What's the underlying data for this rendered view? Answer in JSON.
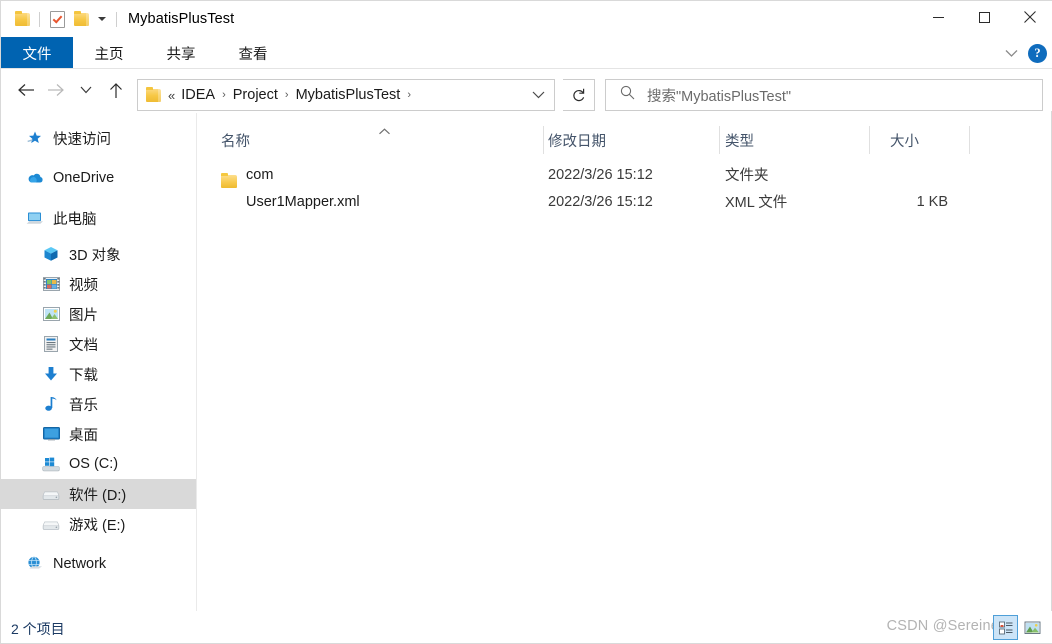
{
  "window": {
    "title": "MybatisPlusTest",
    "quick_access": [
      {
        "name": "folder-icon",
        "label": "文件夹"
      },
      {
        "name": "properties-icon",
        "label": "属性"
      },
      {
        "name": "new-folder-icon",
        "label": "新建文件夹"
      },
      {
        "name": "customize-caret-icon",
        "label": "自定义快速访问工具栏"
      }
    ],
    "controls": {
      "minimize": "最小化",
      "maximize": "最大化",
      "close": "关闭"
    }
  },
  "ribbon": {
    "tabs": [
      {
        "label": "文件",
        "active": true
      },
      {
        "label": "主页",
        "active": false
      },
      {
        "label": "共享",
        "active": false
      },
      {
        "label": "查看",
        "active": false
      }
    ],
    "collapse_icon": "chevron-down-icon",
    "help_label": "?"
  },
  "navigation": {
    "back_label": "返回",
    "forward_label": "前进",
    "recent_label": "最近使用的位置",
    "up_label": "向上",
    "breadcrumb": {
      "overflow": "«",
      "items": [
        "IDEA",
        "Project",
        "MybatisPlusTest"
      ],
      "separator": "›",
      "trailing_separator": "›"
    },
    "refresh_label": "刷新",
    "search": {
      "placeholder": "搜索\"MybatisPlusTest\"",
      "icon": "search-icon"
    }
  },
  "sidebar": {
    "items": [
      {
        "label": "快速访问",
        "icon": "star-pin-icon",
        "indent": 0,
        "selected": false
      },
      {
        "label": "OneDrive",
        "icon": "cloud-icon",
        "indent": 0,
        "selected": false
      },
      {
        "label": "此电脑",
        "icon": "this-pc-icon",
        "indent": 0,
        "selected": false
      },
      {
        "label": "3D 对象",
        "icon": "3d-objects-icon",
        "indent": 1,
        "selected": false
      },
      {
        "label": "视频",
        "icon": "videos-icon",
        "indent": 1,
        "selected": false
      },
      {
        "label": "图片",
        "icon": "pictures-icon",
        "indent": 1,
        "selected": false
      },
      {
        "label": "文档",
        "icon": "documents-icon",
        "indent": 1,
        "selected": false
      },
      {
        "label": "下载",
        "icon": "downloads-icon",
        "indent": 1,
        "selected": false
      },
      {
        "label": "音乐",
        "icon": "music-icon",
        "indent": 1,
        "selected": false
      },
      {
        "label": "桌面",
        "icon": "desktop-icon",
        "indent": 1,
        "selected": false
      },
      {
        "label": "OS (C:)",
        "icon": "windows-drive-icon",
        "indent": 1,
        "selected": false
      },
      {
        "label": "软件 (D:)",
        "icon": "drive-icon",
        "indent": 1,
        "selected": true
      },
      {
        "label": "游戏 (E:)",
        "icon": "drive-icon",
        "indent": 1,
        "selected": false
      },
      {
        "label": "Network",
        "icon": "network-icon",
        "indent": 0,
        "selected": false
      }
    ]
  },
  "filelist": {
    "columns": [
      {
        "label": "名称",
        "sorted": true,
        "sort_direction": "asc"
      },
      {
        "label": "修改日期",
        "sorted": false
      },
      {
        "label": "类型",
        "sorted": false
      },
      {
        "label": "大小",
        "sorted": false
      }
    ],
    "rows": [
      {
        "name": "com",
        "icon": "folder-icon",
        "date": "2022/3/26 15:12",
        "type": "文件夹",
        "size": ""
      },
      {
        "name": "User1Mapper.xml",
        "icon": "xml-file-icon",
        "date": "2022/3/26 15:12",
        "type": "XML 文件",
        "size": "1 KB"
      }
    ]
  },
  "statusbar": {
    "item_count": "2 个项目",
    "watermark": "CSDN @Sereine",
    "view_buttons": [
      {
        "name": "details-view-button",
        "label": "详细信息",
        "active": true
      },
      {
        "name": "large-icons-view-button",
        "label": "大图标",
        "active": false
      }
    ]
  },
  "colors": {
    "accent": "#0063b1",
    "tab_active_bg": "#0063b1",
    "sidebar_selected": "#d9d9d9",
    "column_header_text": "#44546a",
    "status_text": "#1b3a63",
    "watermark": "#b3b3b3",
    "folder_yellow": "#f7c846",
    "xml_green": "#2e9e52"
  }
}
